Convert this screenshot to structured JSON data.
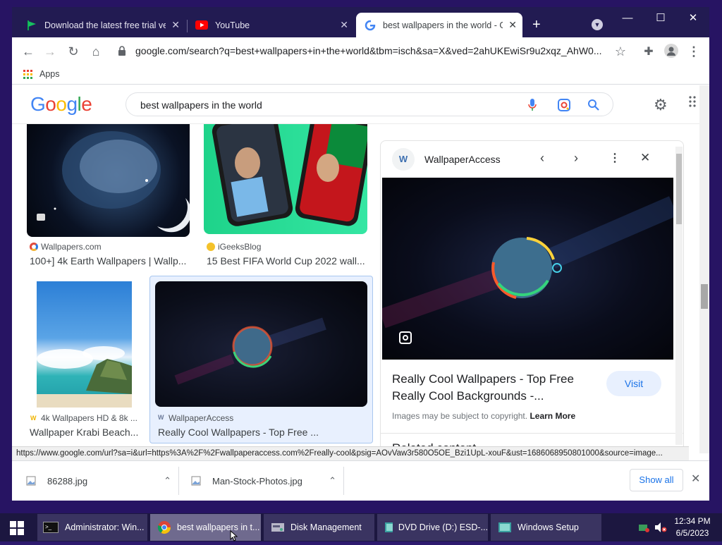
{
  "browser": {
    "tabs": [
      {
        "title": "Download the latest free trial ver",
        "active": false
      },
      {
        "title": "YouTube",
        "active": false
      },
      {
        "title": "best wallpapers in the world - Go",
        "active": true
      }
    ],
    "new_tab": "+",
    "url": "google.com/search?q=best+wallpapers+in+the+world&tbm=isch&sa=X&ved=2ahUKEwiSr9u2xqz_AhW0...",
    "bookmarks": {
      "apps_label": "Apps"
    }
  },
  "google": {
    "logo": "Google",
    "query": "best wallpapers in the world"
  },
  "results": [
    {
      "source": "Wallpapers.com",
      "caption": "100+] 4k Earth Wallpapers | Wallp..."
    },
    {
      "source": "iGeeksBlog",
      "caption": "15 Best FIFA World Cup 2022 wall..."
    },
    {
      "source": "4k Wallpapers HD & 8k ...",
      "caption": "Wallpaper Krabi Beach..."
    },
    {
      "source": "WallpaperAccess",
      "caption": "Really Cool Wallpapers - Top Free ..."
    }
  ],
  "panel": {
    "site": "WallpaperAccess",
    "title": "Really Cool Wallpapers - Top Free Really Cool Backgrounds -...",
    "visit": "Visit",
    "copyright": "Images may be subject to copyright.",
    "learn_more": "Learn More",
    "related": "Related content"
  },
  "status_url": "https://www.google.com/url?sa=i&url=https%3A%2F%2Fwallpaperaccess.com%2Freally-cool&psig=AOvVaw3r580O5OE_Bzi1UpL-xouF&ust=1686068950801000&source=image...",
  "downloads": [
    {
      "name": "86288.jpg"
    },
    {
      "name": "Man-Stock-Photos.jpg"
    }
  ],
  "show_all": "Show all",
  "taskbar": {
    "items": [
      {
        "label": "Administrator: Win..."
      },
      {
        "label": "best wallpapers in t..."
      },
      {
        "label": "Disk Management"
      },
      {
        "label": "DVD Drive (D:) ESD-..."
      },
      {
        "label": "Windows Setup"
      }
    ],
    "time": "12:34 PM",
    "date": "6/5/2023"
  }
}
